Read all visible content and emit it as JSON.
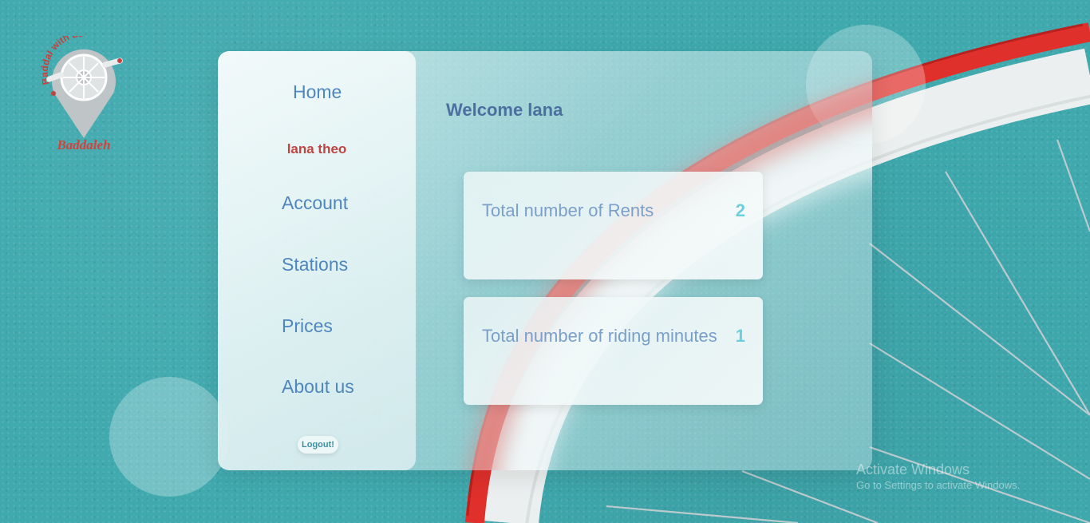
{
  "brand": {
    "logo_top_text": "Baddal with us",
    "logo_bottom_text": "Baddaleh"
  },
  "sidebar": {
    "home_label": "Home",
    "username": "lana theo",
    "items": [
      {
        "label": "Account"
      },
      {
        "label": "Stations"
      },
      {
        "label": "Prices"
      },
      {
        "label": "About us"
      }
    ],
    "logout_label": "Logout!"
  },
  "main": {
    "welcome": "Welcome lana",
    "stats": [
      {
        "label": "Total number of Rents",
        "value": "2"
      },
      {
        "label": "Total number of riding minutes",
        "value": "1"
      }
    ]
  },
  "watermark": {
    "title": "Activate Windows",
    "subtitle": "Go to Settings to activate Windows."
  },
  "colors": {
    "background": "#3fa9ae",
    "nav_text": "#4e86bd",
    "username": "#c0443f",
    "welcome": "#4d6fa0",
    "stat_label": "#7a9fc9",
    "stat_value": "#6dcfdd",
    "tire_red": "#e0302b"
  }
}
